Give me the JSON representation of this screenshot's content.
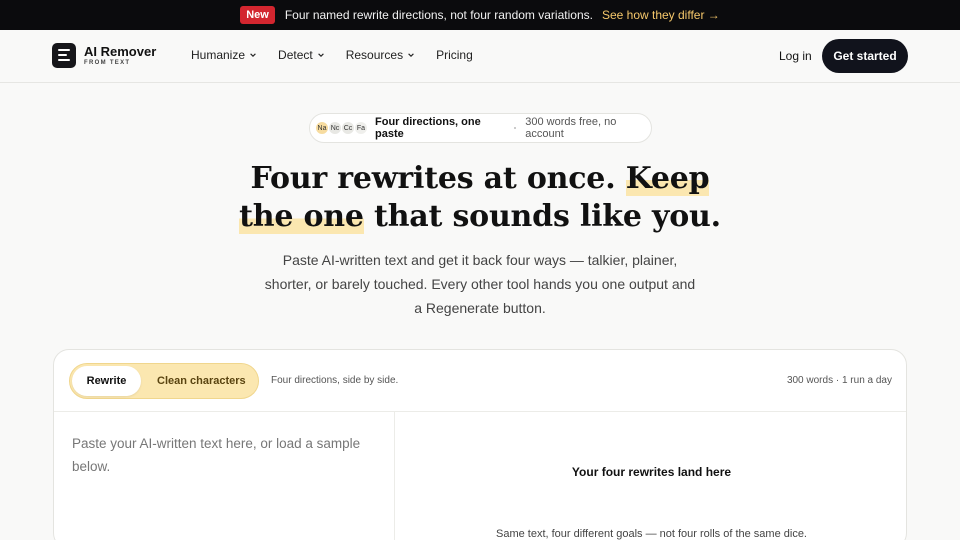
{
  "announcement": {
    "badge": "New",
    "message": "Four named rewrite directions, not four random variations.",
    "link": "See how they differ →"
  },
  "brand": {
    "title": "AI Remover",
    "subtitle": "FROM TEXT"
  },
  "nav": {
    "items": [
      {
        "label": "Humanize",
        "has_dropdown": true
      },
      {
        "label": "Detect",
        "has_dropdown": true
      },
      {
        "label": "Resources",
        "has_dropdown": true
      },
      {
        "label": "Pricing",
        "has_dropdown": false
      }
    ],
    "login": "Log in",
    "cta": "Get started"
  },
  "hero": {
    "pill": {
      "avatars": [
        {
          "label": "Na",
          "color": "#f7dca0"
        },
        {
          "label": "Nc",
          "color": "#e8e8e4"
        },
        {
          "label": "Cc",
          "color": "#e8e8e4"
        },
        {
          "label": "Fa",
          "color": "#efefec"
        }
      ],
      "title": "Four directions, one paste",
      "note": "300 words free, no account"
    },
    "headline_line1_plain": "Four rewrites at once. ",
    "headline_line1_highlight": "Keep",
    "headline_line2_highlight": "the one",
    "headline_line2_plain": " that sounds like you.",
    "subtitle": "Paste AI-written text and get it back four ways — talkier, plainer, shorter, or barely touched. Every other tool hands you one output and a Regenerate button."
  },
  "tool": {
    "tabs": [
      {
        "label": "Rewrite",
        "active": true
      },
      {
        "label": "Clean characters",
        "active": false
      }
    ],
    "description": "Four directions, side by side.",
    "meta": "300 words · 1 run a day",
    "input_placeholder": "Paste your AI-written text here, or load a sample below.",
    "output_title": "Your four rewrites land here",
    "output_subtitle": "Same text, four different goals — not four rolls of the same dice."
  },
  "colors": {
    "announcement_bg": "#0b0b0d",
    "badge_bg": "#d3262f",
    "link": "#f6c86b",
    "highlight": "#fbe7b0",
    "cta_bg": "#11131c"
  }
}
